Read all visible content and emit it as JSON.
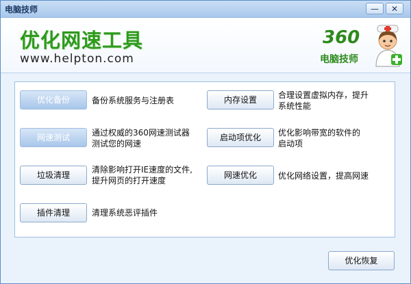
{
  "window": {
    "title": "电脑技师",
    "minimize_symbol": "—",
    "close_symbol": "✕"
  },
  "header": {
    "title": "优化网速工具",
    "url": "www.helpton.com",
    "logo_number": "360",
    "logo_text": "电脑技师",
    "brand_color": "#2e9a1c",
    "mascot_icon": "doctor-mascot-icon"
  },
  "tools": [
    {
      "label": "优化备份",
      "description": "备份系统服务与注册表",
      "state": "disabled"
    },
    {
      "label": "网速测试",
      "description": "通过权威的360网速测试器\n测试您的网速",
      "state": "disabled"
    },
    {
      "label": "垃圾清理",
      "description": "清除影响打开IE速度的文件,\n提升网页的打开速度",
      "state": "enabled"
    },
    {
      "label": "插件清理",
      "description": "清理系统恶评插件",
      "state": "enabled"
    },
    {
      "label": "内存设置",
      "description": "合理设置虚拟内存，提升\n系统性能",
      "state": "enabled"
    },
    {
      "label": "启动项优化",
      "description": "优化影响带宽的软件的\n启动项",
      "state": "enabled"
    },
    {
      "label": "网速优化",
      "description": "优化网络设置，提高网速",
      "state": "enabled"
    }
  ],
  "footer": {
    "restore_label": "优化恢复"
  }
}
